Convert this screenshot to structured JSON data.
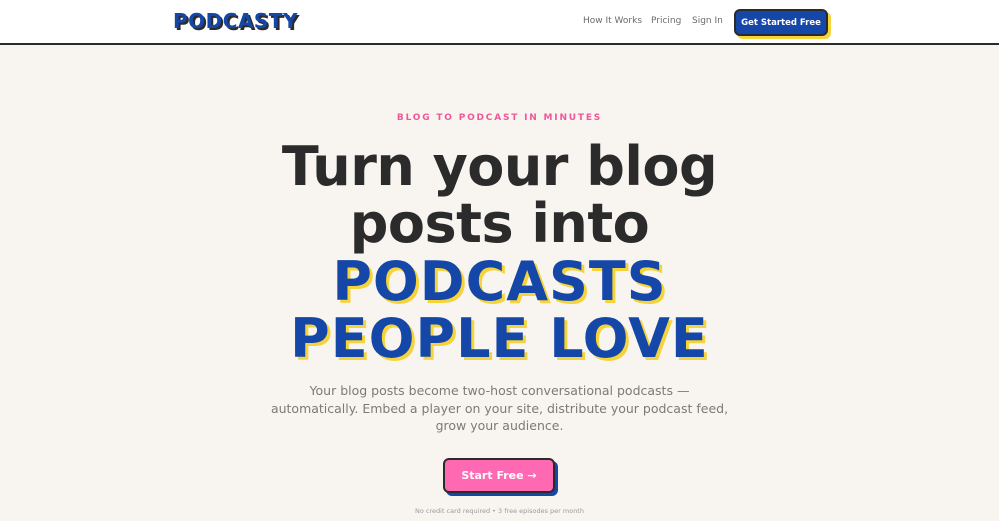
{
  "header": {
    "logo": "PODCASTY",
    "nav": {
      "how_it_works": "How It Works",
      "pricing": "Pricing",
      "sign_in": "Sign In"
    },
    "cta": "Get Started Free"
  },
  "hero": {
    "eyebrow": "BLOG TO PODCAST IN MINUTES",
    "headline_line1": "Turn your blog",
    "headline_line2": "posts into",
    "headline_accent_line1": "PODCASTS",
    "headline_accent_line2": "PEOPLE LOVE",
    "subtitle_line1": "Your blog posts become two-host conversational podcasts —",
    "subtitle_line2": "automatically. Embed a player on your site, distribute your podcast feed,",
    "subtitle_line3": "grow your audience.",
    "cta": "Start Free →",
    "note": "No credit card required • 3 free episodes per month"
  },
  "colors": {
    "brand_blue": "#1547a8",
    "accent_pink": "#ff69b4",
    "shadow_yellow": "#f5d33a",
    "background": "#f8f5f0"
  }
}
